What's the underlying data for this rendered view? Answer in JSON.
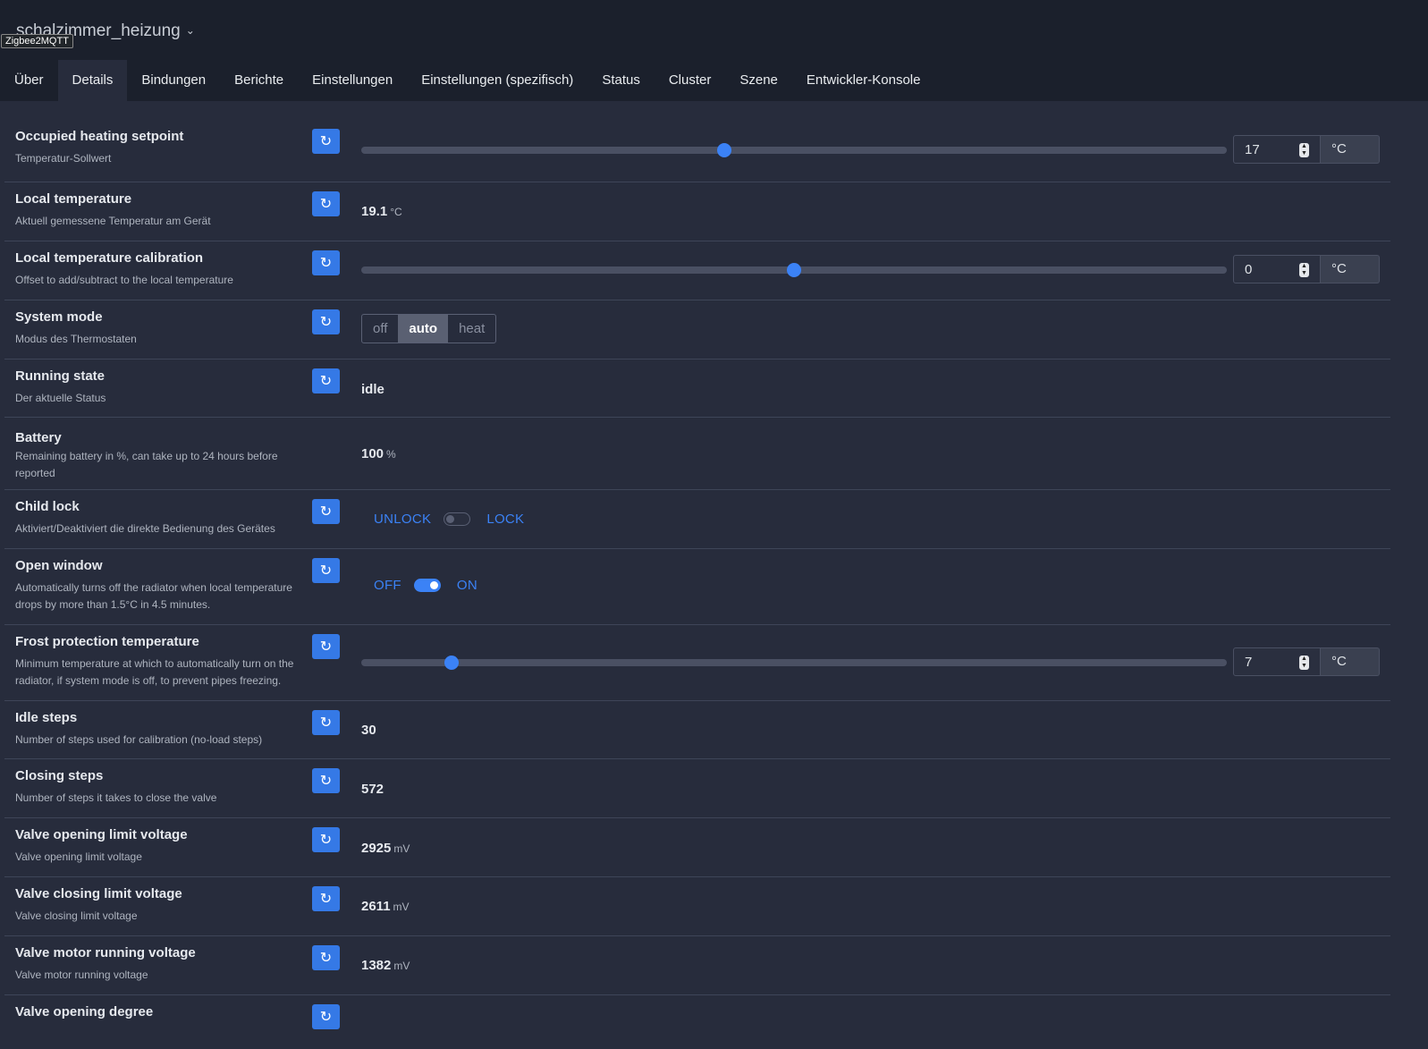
{
  "header": {
    "device_name": "schalzimmer_heizung",
    "tooltip": "Zigbee2MQTT"
  },
  "tabs": [
    {
      "label": "Über"
    },
    {
      "label": "Details"
    },
    {
      "label": "Bindungen"
    },
    {
      "label": "Berichte"
    },
    {
      "label": "Einstellungen"
    },
    {
      "label": "Einstellungen (spezifisch)"
    },
    {
      "label": "Status"
    },
    {
      "label": "Cluster"
    },
    {
      "label": "Szene"
    },
    {
      "label": "Entwickler-Konsole"
    }
  ],
  "active_tab": "Details",
  "accent_color": "#3b82f6",
  "rows": {
    "occupied_heating_setpoint": {
      "label": "Occupied heating setpoint",
      "desc": "Temperatur-Sollwert",
      "value": "17",
      "unit": "°C",
      "slider_fraction": 0.42
    },
    "local_temperature": {
      "label": "Local temperature",
      "desc": "Aktuell gemessene Temperatur am Gerät",
      "value": "19.1",
      "unit": "°C"
    },
    "local_temperature_calibration": {
      "label": "Local temperature calibration",
      "desc": "Offset to add/subtract to the local temperature",
      "value": "0",
      "unit": "°C",
      "slider_fraction": 0.5
    },
    "system_mode": {
      "label": "System mode",
      "desc": "Modus des Thermostaten",
      "options": [
        "off",
        "auto",
        "heat"
      ],
      "selected": "auto"
    },
    "running_state": {
      "label": "Running state",
      "desc": "Der aktuelle Status",
      "value": "idle"
    },
    "battery": {
      "label": "Battery",
      "desc": "Remaining battery in %, can take up to 24 hours before reported",
      "value": "100",
      "unit": "%"
    },
    "child_lock": {
      "label": "Child lock",
      "desc": "Aktiviert/Deaktiviert die direkte Bedienung des Gerätes",
      "off_label": "UNLOCK",
      "on_label": "LOCK",
      "state": "off"
    },
    "open_window": {
      "label": "Open window",
      "desc": "Automatically turns off the radiator when local temperature drops by more than 1.5°C in 4.5 minutes.",
      "off_label": "OFF",
      "on_label": "ON",
      "state": "on"
    },
    "frost_protection_temperature": {
      "label": "Frost protection temperature",
      "desc": "Minimum temperature at which to automatically turn on the radiator, if system mode is off, to prevent pipes freezing.",
      "value": "7",
      "unit": "°C",
      "slider_fraction": 0.1
    },
    "idle_steps": {
      "label": "Idle steps",
      "desc": "Number of steps used for calibration (no-load steps)",
      "value": "30"
    },
    "closing_steps": {
      "label": "Closing steps",
      "desc": "Number of steps it takes to close the valve",
      "value": "572"
    },
    "valve_opening_limit_voltage": {
      "label": "Valve opening limit voltage",
      "desc": "Valve opening limit voltage",
      "value": "2925",
      "unit": "mV"
    },
    "valve_closing_limit_voltage": {
      "label": "Valve closing limit voltage",
      "desc": "Valve closing limit voltage",
      "value": "2611",
      "unit": "mV"
    },
    "valve_motor_running_voltage": {
      "label": "Valve motor running voltage",
      "desc": "Valve motor running voltage",
      "value": "1382",
      "unit": "mV"
    },
    "valve_opening_degree": {
      "label": "Valve opening degree"
    }
  }
}
